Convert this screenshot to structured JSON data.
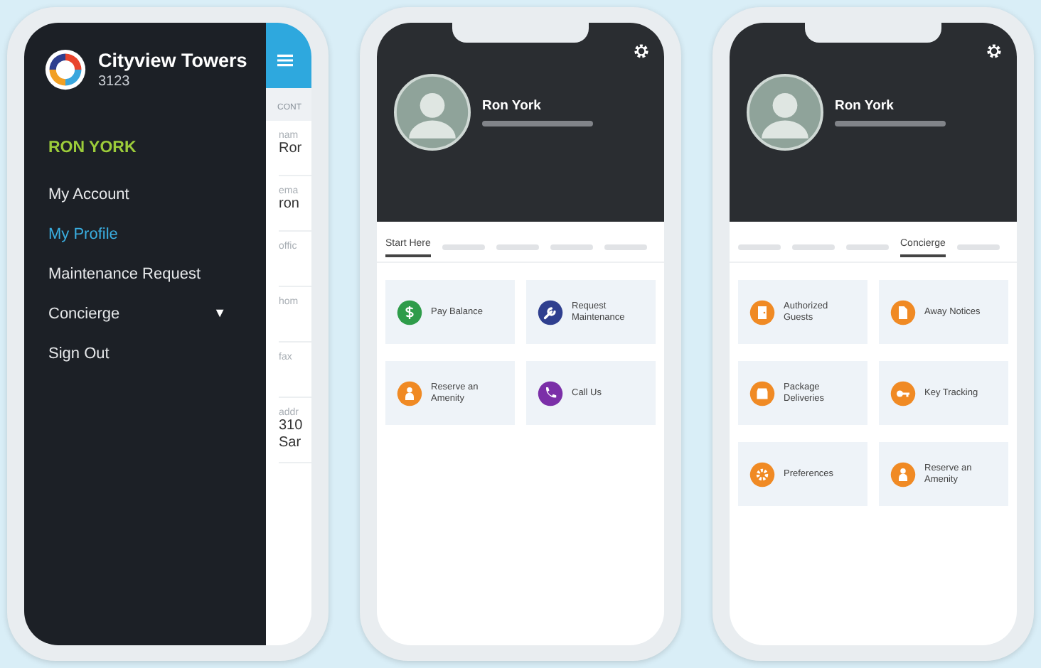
{
  "phones": [
    {
      "kind": "drawer",
      "app": {
        "name": "Cityview Towers",
        "unit": "3123"
      },
      "user_name": "RON YORK",
      "menu": [
        {
          "label": "My Account",
          "selected": false
        },
        {
          "label": "My Profile",
          "selected": true
        },
        {
          "label": "Maintenance Request",
          "selected": false
        },
        {
          "label": "Concierge",
          "selected": false,
          "caret": "▼"
        },
        {
          "label": "Sign Out",
          "selected": false
        }
      ],
      "behind": {
        "section": "CONT",
        "fields": [
          {
            "label": "nam",
            "value": [
              "Ror"
            ]
          },
          {
            "label": "ema",
            "value": [
              "ron"
            ]
          },
          {
            "label": "offic"
          },
          {
            "label": "hom"
          },
          {
            "label": "fax"
          },
          {
            "label": "addr",
            "value": [
              "310",
              "Sar"
            ]
          }
        ]
      }
    },
    {
      "kind": "dashboard",
      "profile": {
        "name": "Ron York"
      },
      "tabs": [
        {
          "kind": "text",
          "label": "Start Here",
          "selected": true
        },
        {
          "kind": "blurred",
          "selected": false
        },
        {
          "kind": "blurred",
          "selected": false
        },
        {
          "kind": "blurred",
          "selected": false
        },
        {
          "kind": "blurred",
          "selected": false
        }
      ],
      "tiles": [
        {
          "label": "Pay Balance",
          "kind": "dollar",
          "color": "#2e9c4a"
        },
        {
          "label": "Request Maintenance",
          "kind": "wrench",
          "color": "#2f3f8f"
        },
        {
          "label": "Reserve an Amenity",
          "kind": "person",
          "color": "#f08a24"
        },
        {
          "label": "Call Us",
          "kind": "phone",
          "color": "#7b2fa8"
        }
      ]
    },
    {
      "kind": "dashboard",
      "profile": {
        "name": "Ron York"
      },
      "tabs": [
        {
          "kind": "blurred",
          "selected": false
        },
        {
          "kind": "blurred",
          "selected": false
        },
        {
          "kind": "blurred",
          "selected": false
        },
        {
          "kind": "text",
          "label": "Concierge",
          "selected": true
        },
        {
          "kind": "blurred",
          "selected": false
        }
      ],
      "tiles": [
        {
          "label": "Authorized Guests",
          "kind": "door",
          "color": "#f08a24"
        },
        {
          "label": "Away Notices",
          "kind": "document",
          "color": "#f08a24"
        },
        {
          "label": "Package Deliveries",
          "kind": "box",
          "color": "#f08a24"
        },
        {
          "label": "Key Tracking",
          "kind": "key",
          "color": "#f08a24"
        },
        {
          "label": "Preferences",
          "kind": "gear",
          "color": "#f08a24"
        },
        {
          "label": "Reserve an Amenity",
          "kind": "person",
          "color": "#f08a24"
        }
      ]
    }
  ]
}
